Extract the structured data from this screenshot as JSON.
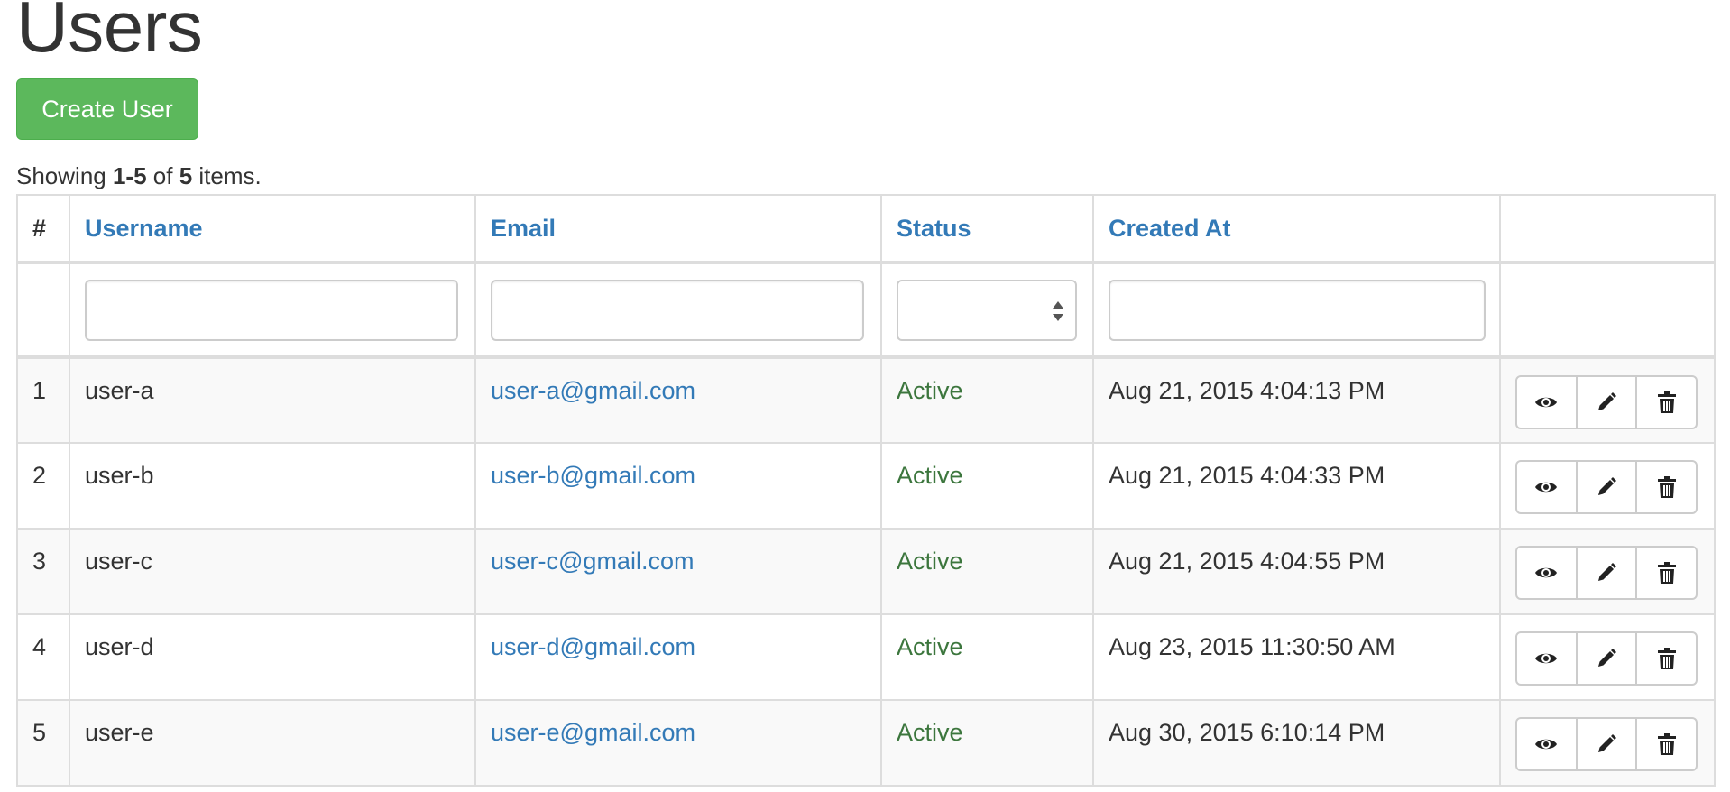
{
  "page": {
    "title": "Users",
    "create_label": "Create User"
  },
  "summary": {
    "prefix": "Showing ",
    "range": "1-5",
    "middle": " of ",
    "total": "5",
    "suffix": " items."
  },
  "table": {
    "headers": {
      "num": "#",
      "username": "Username",
      "email": "Email",
      "status": "Status",
      "created_at": "Created At"
    },
    "filters": {
      "username": "",
      "email": "",
      "status": "",
      "created_at": ""
    },
    "rows": [
      {
        "num": "1",
        "username": "user-a",
        "email": "user-a@gmail.com",
        "status": "Active",
        "created_at": "Aug 21, 2015 4:04:13 PM"
      },
      {
        "num": "2",
        "username": "user-b",
        "email": "user-b@gmail.com",
        "status": "Active",
        "created_at": "Aug 21, 2015 4:04:33 PM"
      },
      {
        "num": "3",
        "username": "user-c",
        "email": "user-c@gmail.com",
        "status": "Active",
        "created_at": "Aug 21, 2015 4:04:55 PM"
      },
      {
        "num": "4",
        "username": "user-d",
        "email": "user-d@gmail.com",
        "status": "Active",
        "created_at": "Aug 23, 2015 11:30:50 AM"
      },
      {
        "num": "5",
        "username": "user-e",
        "email": "user-e@gmail.com",
        "status": "Active",
        "created_at": "Aug 30, 2015 6:10:14 PM"
      }
    ],
    "row_actions": [
      "eye-icon",
      "pencil-icon",
      "trash-icon"
    ]
  },
  "colors": {
    "primary_link": "#337ab7",
    "success_button": "#5cb85c",
    "status_active": "#3c763d",
    "border": "#dddddd",
    "stripe": "#f9f9f9"
  }
}
